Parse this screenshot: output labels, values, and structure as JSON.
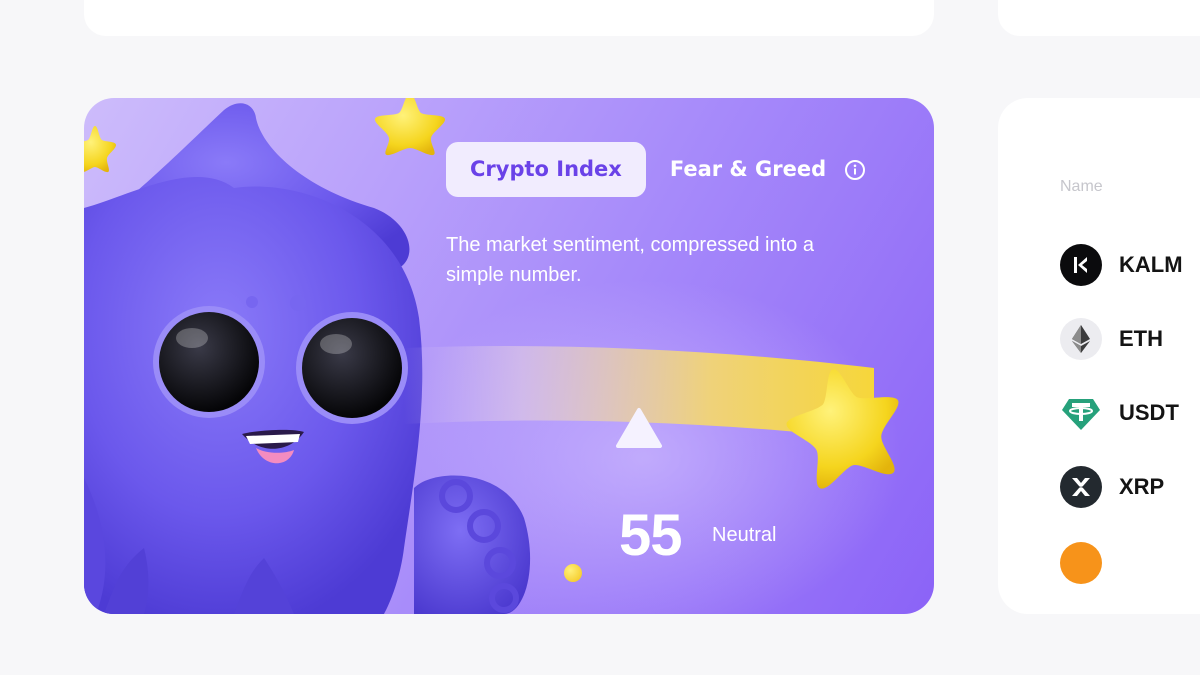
{
  "tabs": [
    {
      "label": "Crypto Index",
      "active": true
    },
    {
      "label": "Fear & Greed",
      "active": false
    }
  ],
  "subtitle": "The market sentiment, compressed into a simple number.",
  "index": {
    "value": "55",
    "label": "Neutral"
  },
  "list": {
    "header": "Name",
    "coins": [
      {
        "symbol": "KALM",
        "icon": "kalm-icon"
      },
      {
        "symbol": "ETH",
        "icon": "ethereum-icon"
      },
      {
        "symbol": "USDT",
        "icon": "tether-icon"
      },
      {
        "symbol": "XRP",
        "icon": "xrp-icon"
      }
    ]
  },
  "colors": {
    "accent": "#6a42e8",
    "hero_gradient_start": "#cdbcfb",
    "hero_gradient_end": "#8b63f7",
    "star": "#f5d51e",
    "tether": "#26a17b"
  }
}
